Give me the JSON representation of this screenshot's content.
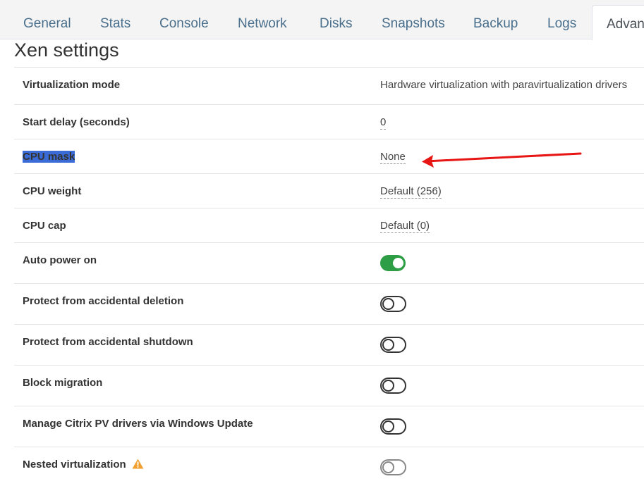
{
  "tabs": [
    {
      "label": "General"
    },
    {
      "label": "Stats"
    },
    {
      "label": "Console"
    },
    {
      "label": "Network"
    },
    {
      "label": "Disks"
    },
    {
      "label": "Snapshots"
    },
    {
      "label": "Backup"
    },
    {
      "label": "Logs"
    },
    {
      "label": "Advan"
    }
  ],
  "section": {
    "title": "Xen settings"
  },
  "settings": {
    "virtualization_mode": {
      "label": "Virtualization mode",
      "value": "Hardware virtualization with paravirtualization drivers"
    },
    "start_delay": {
      "label": "Start delay (seconds)",
      "value": "0"
    },
    "cpu_mask": {
      "label": "CPU mask",
      "value": "None"
    },
    "cpu_weight": {
      "label": "CPU weight",
      "value": "Default (256)"
    },
    "cpu_cap": {
      "label": "CPU cap",
      "value": "Default (0)"
    },
    "auto_power_on": {
      "label": "Auto power on",
      "enabled": true
    },
    "protect_deletion": {
      "label": "Protect from accidental deletion",
      "enabled": false
    },
    "protect_shutdown": {
      "label": "Protect from accidental shutdown",
      "enabled": false
    },
    "block_migration": {
      "label": "Block migration",
      "enabled": false
    },
    "citrix_pv": {
      "label": "Manage Citrix PV drivers via Windows Update",
      "enabled": false
    },
    "nested_virtualization": {
      "label": "Nested virtualization",
      "enabled": false,
      "disabled": true,
      "icon": "warning-icon"
    }
  },
  "colors": {
    "toggle_on": "#2e9e46",
    "arrow": "#e81515",
    "warning": "#f0a030",
    "selection": "#3a6bd6"
  }
}
